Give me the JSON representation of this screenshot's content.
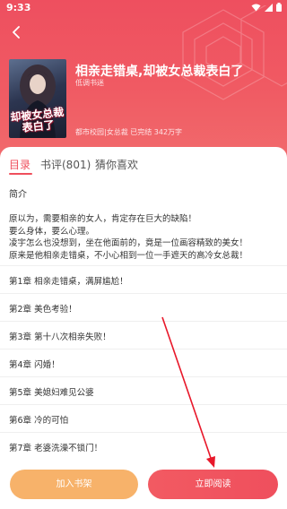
{
  "status_bar": {
    "time": "9:33"
  },
  "colors": {
    "brand_red": "#ef4f5c",
    "shelf_orange": "#f7b26a",
    "annotation_arrow": "#e8182a"
  },
  "book": {
    "title": "相亲走错桌,却被女总裁表白了",
    "author": "低调书迷",
    "meta": "都市校园|女总裁 已完结 342万字",
    "cover_art_text": "却被女总裁表白了"
  },
  "tabs": [
    {
      "label": "目录",
      "active": true
    },
    {
      "label": "书评(801)",
      "active": false
    },
    {
      "label": "猜你喜欢",
      "active": false
    }
  ],
  "intro": {
    "heading": "简介",
    "lines": [
      "原以为，需要相亲的女人，肯定存在巨大的缺陷！",
      "要么身体，要么心理。",
      "凌宇怎么也没想到，坐在他面前的，竟是一位画容精致的美女！",
      "原来是他相亲走错桌，不小心相到一位一手遮天的高冷女总裁！"
    ]
  },
  "chapters": [
    "第1章 相亲走错桌，满屏尴尬！",
    "第2章 美色考验！",
    "第3章 第十八次相亲失败！",
    "第4章 闪婚！",
    "第5章 美媳妇难见公婆",
    "第6章 冷的可怕",
    "第7章 老婆洗澡不锁门！"
  ],
  "actions": {
    "add_shelf": "加入书架",
    "read_now": "立即阅读"
  },
  "icons": {
    "back": "back-arrow-icon",
    "wifi": "wifi-icon",
    "signal": "signal-icon",
    "battery": "battery-icon"
  }
}
